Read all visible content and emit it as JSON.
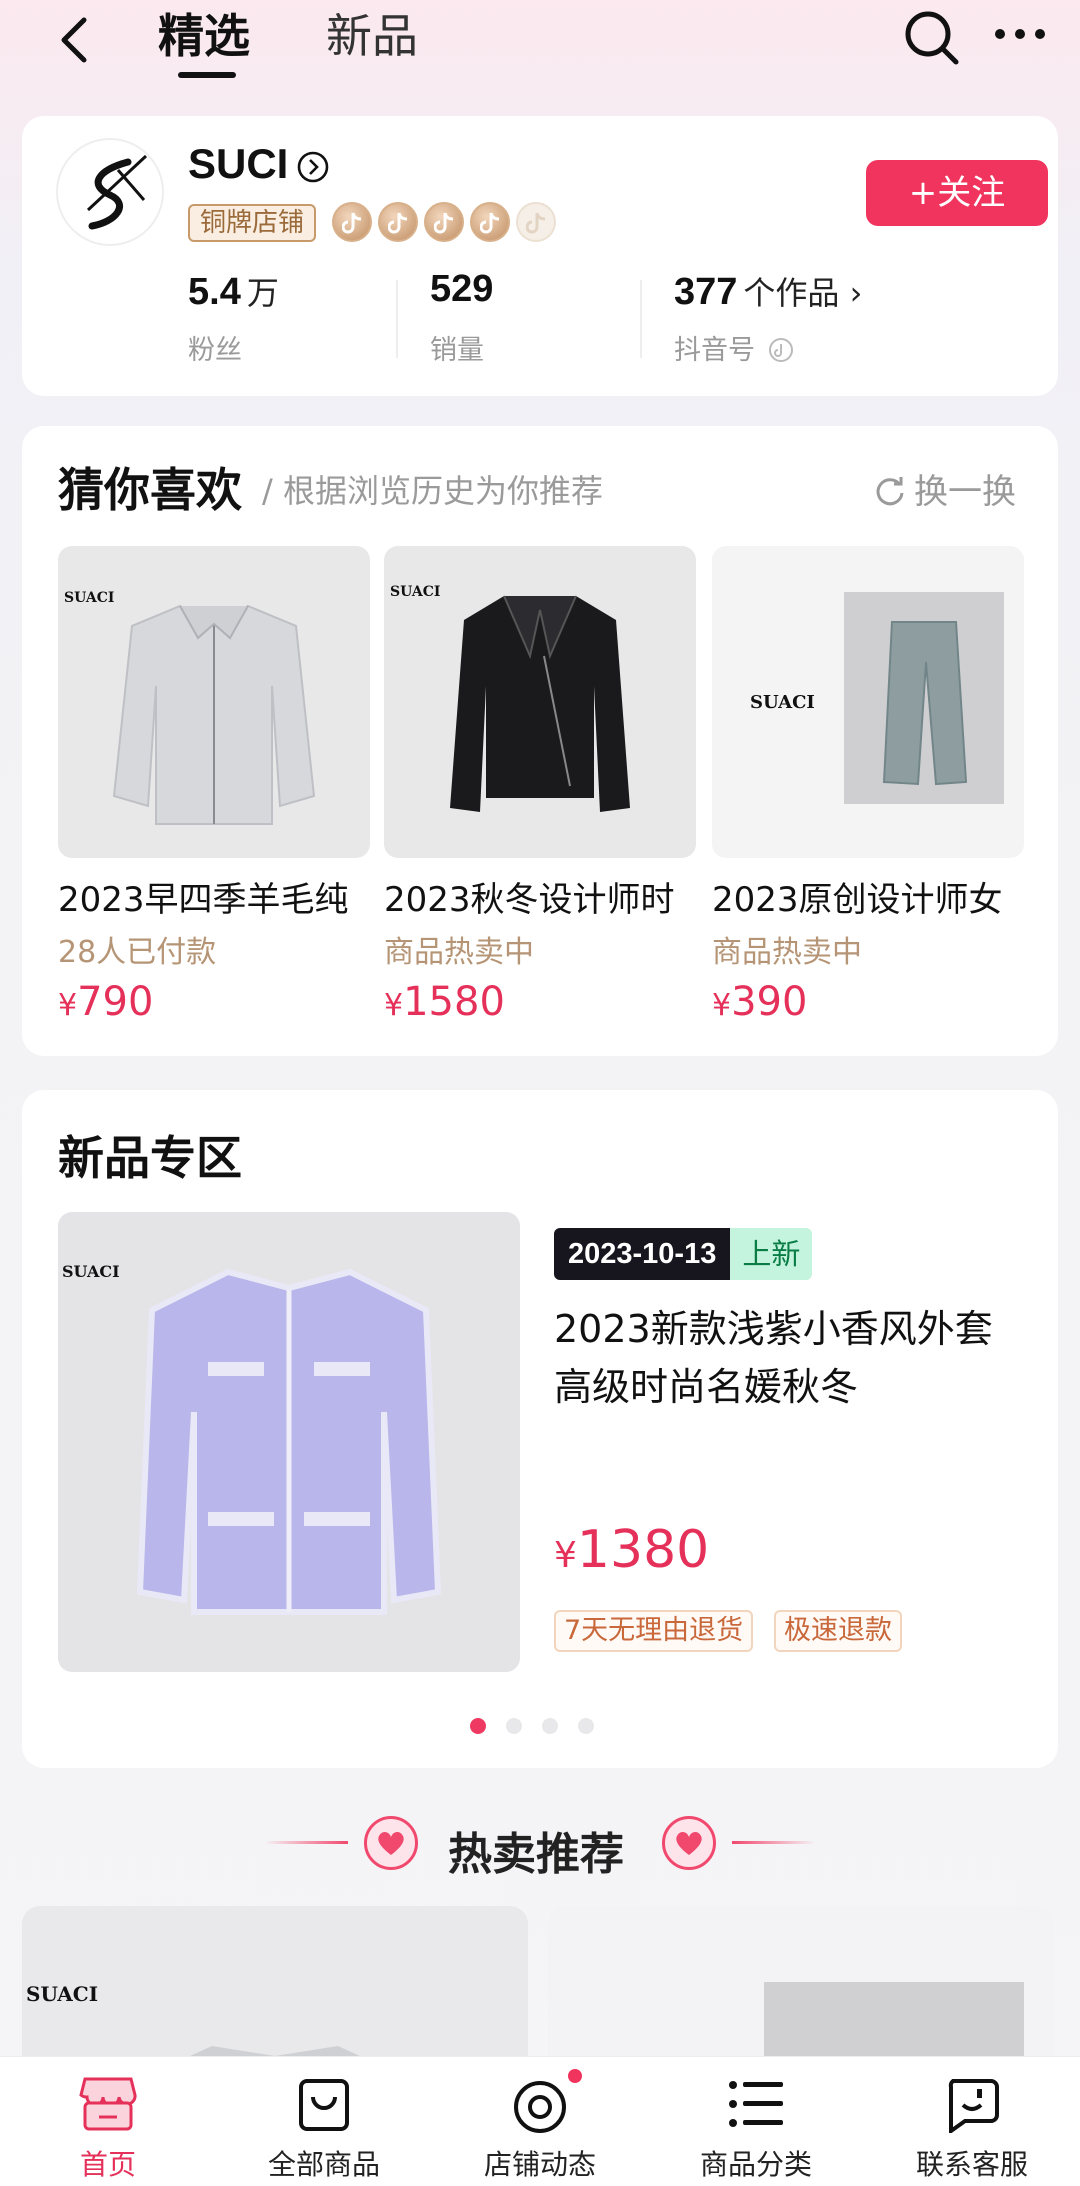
{
  "top_nav": {
    "tabs": [
      "精选",
      "新品"
    ]
  },
  "shop": {
    "name": "SUCI",
    "level_badge": "铜牌店铺",
    "follow_label": "+关注",
    "stats": [
      {
        "value": "5.4",
        "unit": "万",
        "label": "粉丝"
      },
      {
        "value": "529",
        "unit": "",
        "label": "销量"
      },
      {
        "value": "377",
        "unit": "个作品 ›",
        "label": "抖音号"
      }
    ],
    "medals_earned": 4,
    "medals_total": 5
  },
  "guess": {
    "title": "猜你喜欢",
    "subtitle": "/ 根据浏览历史为你推荐",
    "refresh_label": "换一换",
    "products": [
      {
        "title": "2023早四季羊毛纯",
        "sub": "28人已付款",
        "currency": "¥",
        "price": "790"
      },
      {
        "title": "2023秋冬设计师时",
        "sub": "商品热卖中",
        "currency": "¥",
        "price": "1580"
      },
      {
        "title": "2023原创设计师女",
        "sub": "商品热卖中",
        "currency": "¥",
        "price": "390"
      }
    ]
  },
  "new_zone": {
    "title": "新品专区",
    "date": "2023-10-13",
    "tag": "上新",
    "product_title": "2023新款浅紫小香风外套高级时尚名媛秋冬",
    "currency": "¥",
    "price": "1380",
    "chips": [
      "7天无理由退货",
      "极速退款"
    ],
    "carousel_total": 4,
    "carousel_active": 1
  },
  "hot": {
    "title": "热卖推荐"
  },
  "brand_mark": "SUACI",
  "bottom_nav": [
    {
      "label": "首页",
      "icon": "shop-home-icon",
      "active": true
    },
    {
      "label": "全部商品",
      "icon": "shopping-bag-icon",
      "active": false
    },
    {
      "label": "店铺动态",
      "icon": "vinyl-record-icon",
      "active": false
    },
    {
      "label": "商品分类",
      "icon": "category-list-icon",
      "active": false
    },
    {
      "label": "联系客服",
      "icon": "chat-service-icon",
      "active": false
    }
  ],
  "colors": {
    "accent": "#e5315a",
    "follow": "#f0345e",
    "badge": "#9a6a3a"
  }
}
